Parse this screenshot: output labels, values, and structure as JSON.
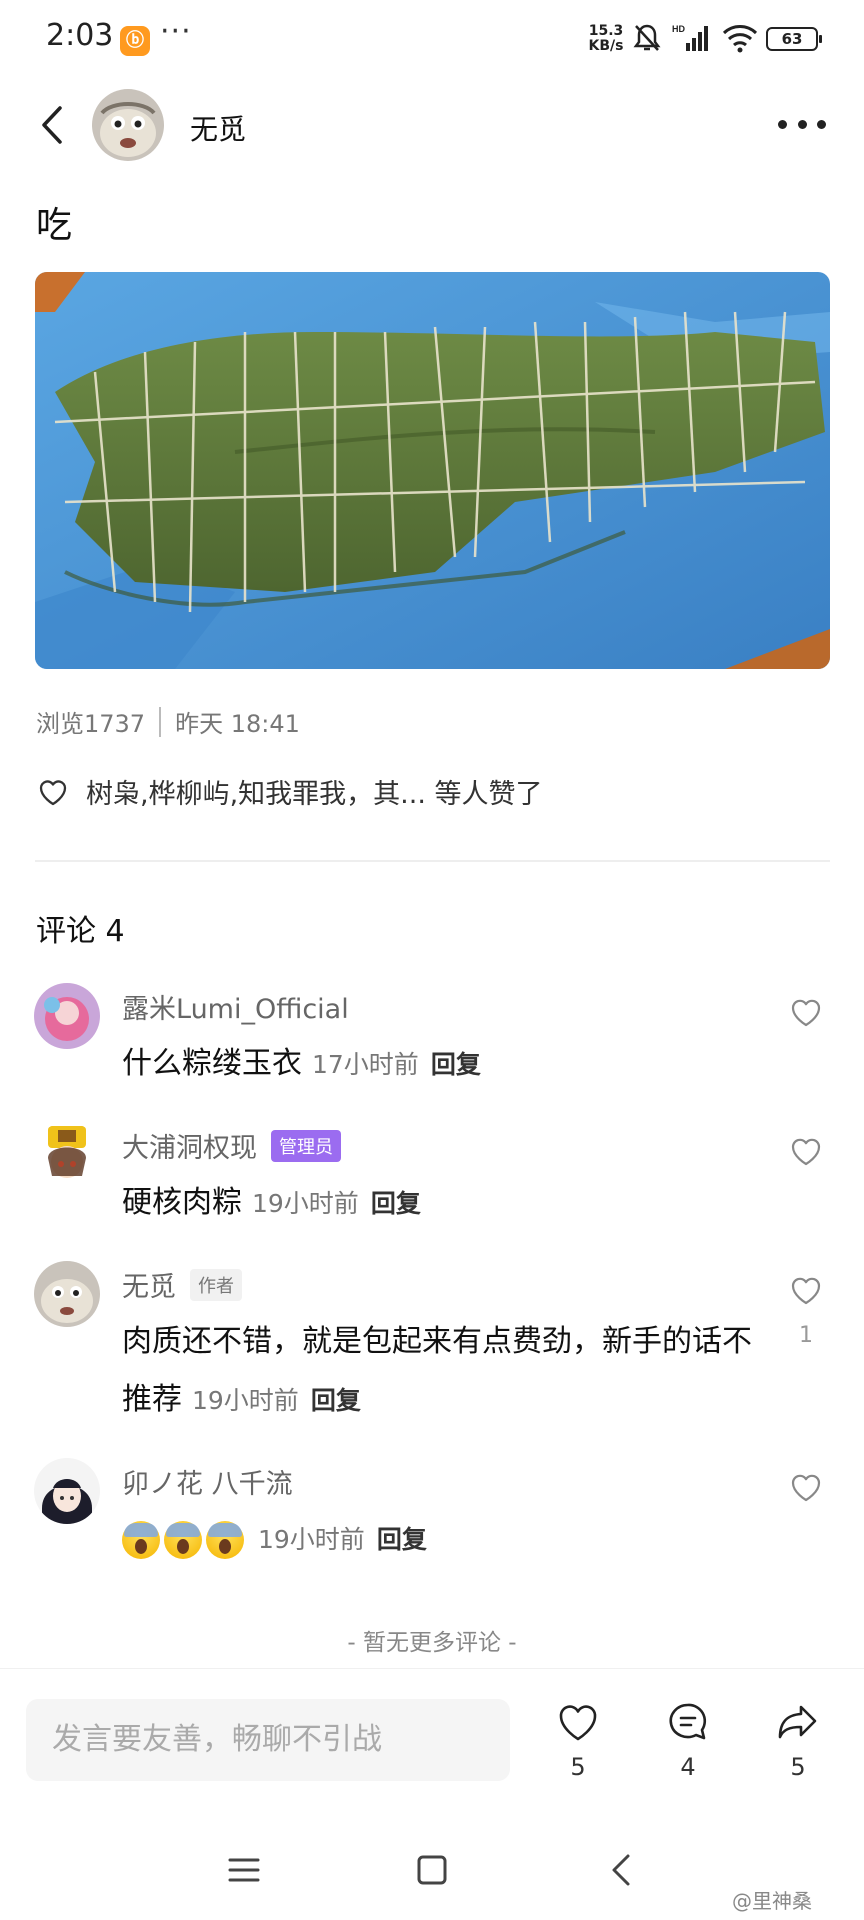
{
  "status_bar": {
    "time": "2:03",
    "dots": "···",
    "net_speed_top": "15.3",
    "net_speed_unit": "KB/s",
    "battery": "63"
  },
  "header": {
    "author_name": "无觅"
  },
  "post": {
    "title": "吃",
    "views": "浏览1737",
    "time": "昨天 18:41",
    "likes_text": "树枭,桦柳屿,知我罪我，其... 等人赞了"
  },
  "comments_section": {
    "heading": "评论 4",
    "no_more": "- 暂无更多评论 -",
    "reply_label": "回复",
    "comments": [
      {
        "name": "露米Lumi_Official",
        "text": "什么粽缕玉衣",
        "time": "17小时前",
        "badge": "",
        "likes": ""
      },
      {
        "name": "大浦洞权现",
        "text": "硬核肉粽",
        "time": "19小时前",
        "badge": "管理员",
        "likes": ""
      },
      {
        "name": "无觅",
        "text": "肉质还不错，就是包起来有点费劲，新手的话不推荐",
        "time": "19小时前",
        "badge": "作者",
        "likes": "1"
      },
      {
        "name": "卯ノ花 八千流",
        "text": "",
        "time": "19小时前",
        "badge": "",
        "likes": ""
      }
    ]
  },
  "bottom_bar": {
    "input_placeholder": "发言要友善，畅聊不引战",
    "like_count": "5",
    "comment_count": "4",
    "share_count": "5"
  },
  "watermark": "@里神桑",
  "colors": {
    "admin_badge": "#9b6cf0",
    "app_badge": "#ff9a1f",
    "tarp_blue": "#4f97d6",
    "leaf_green": "#5f7a3a"
  }
}
